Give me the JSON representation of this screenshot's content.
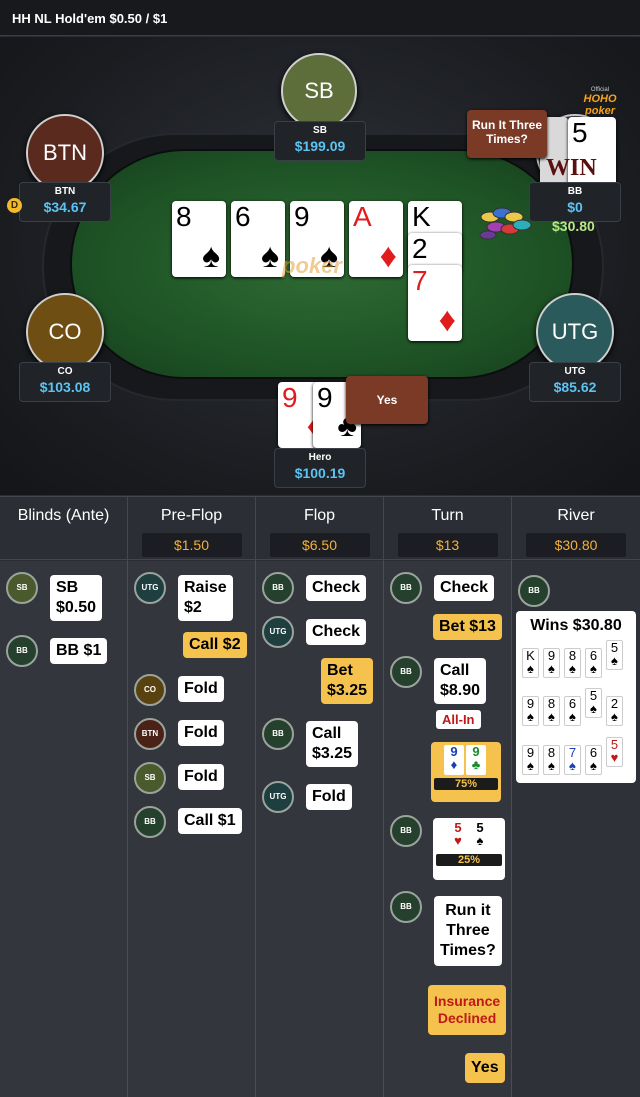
{
  "header": {
    "title": "HH NL Hold'em $0.50 / $1"
  },
  "brand": {
    "top": "Official",
    "name": "HOHO poker"
  },
  "seats": [
    {
      "id": "sb",
      "avatar": "SB",
      "name": "SB",
      "stack": "$199.09",
      "color": "#5d6e3a"
    },
    {
      "id": "btn",
      "avatar": "BTN",
      "name": "BTN",
      "stack": "$34.67",
      "color": "#5a2a1e"
    },
    {
      "id": "bb",
      "avatar": "",
      "name": "BB",
      "stack": "$0",
      "color": "#3a3d44"
    },
    {
      "id": "co",
      "avatar": "CO",
      "name": "CO",
      "stack": "$103.08",
      "color": "#6e4e12"
    },
    {
      "id": "utg",
      "avatar": "UTG",
      "name": "UTG",
      "stack": "$85.62",
      "color": "#2b5a5c"
    },
    {
      "id": "hero",
      "avatar": "",
      "name": "Hero",
      "stack": "$100.19",
      "color": "#8a2020"
    }
  ],
  "dealer_button": "D",
  "board": [
    {
      "rank": "8",
      "suit": "♠",
      "red": false
    },
    {
      "rank": "6",
      "suit": "♠",
      "red": false
    },
    {
      "rank": "9",
      "suit": "♠",
      "red": false
    },
    {
      "rank": "A",
      "suit": "♦",
      "red": true
    },
    {
      "rank": "K",
      "suit": "",
      "red": false
    },
    {
      "rank": "2",
      "suit": "",
      "red": false
    },
    {
      "rank": "7",
      "suit": "♦",
      "red": true
    }
  ],
  "hero_cards": [
    {
      "rank": "9",
      "suit": "♦",
      "red": true
    },
    {
      "rank": "9",
      "suit": "♣",
      "red": false
    }
  ],
  "bb_cards": [
    {
      "rank": "5",
      "suit": "",
      "red": false
    }
  ],
  "bubbles": {
    "run_it": "Run It Three Times?",
    "yes": "Yes",
    "win": "WIN",
    "bb_win_amount": "$30.80"
  },
  "streets": [
    {
      "name": "Blinds (Ante)",
      "pot": ""
    },
    {
      "name": "Pre-Flop",
      "pot": "$1.50"
    },
    {
      "name": "Flop",
      "pot": "$6.50"
    },
    {
      "name": "Turn",
      "pot": "$13"
    },
    {
      "name": "River",
      "pot": "$30.80"
    }
  ],
  "actions": {
    "blinds": [
      {
        "who": "SB",
        "text": "SB\n$0.50"
      },
      {
        "who": "BB",
        "text": "BB  $1"
      }
    ],
    "preflop": [
      {
        "who": "UTG",
        "text": "Raise\n$2"
      },
      {
        "who": "",
        "text": "Call  $2"
      },
      {
        "who": "CO",
        "text": "Fold"
      },
      {
        "who": "BTN",
        "text": "Fold"
      },
      {
        "who": "SB",
        "text": "Fold"
      },
      {
        "who": "BB",
        "text": "Call  $1"
      }
    ],
    "flop": [
      {
        "who": "BB",
        "text": "Check"
      },
      {
        "who": "UTG",
        "text": "Check"
      },
      {
        "who": "",
        "text": "Bet\n$3.25"
      },
      {
        "who": "BB",
        "text": "Call\n$3.25"
      },
      {
        "who": "UTG",
        "text": "Fold"
      }
    ],
    "turn": [
      {
        "who": "BB",
        "text": "Check"
      },
      {
        "who": "",
        "text": "Bet  $13"
      },
      {
        "who": "BB",
        "text": "Call\n$8.90"
      },
      {
        "who": "",
        "text": "All-In"
      },
      {
        "who": "",
        "text": "75%"
      },
      {
        "who": "BB",
        "text": "25%"
      },
      {
        "who": "BB",
        "text": "Run it\nThree\nTimes?"
      },
      {
        "who": "",
        "text": "Insurance\nDeclined"
      },
      {
        "who": "",
        "text": "Yes"
      }
    ],
    "river": {
      "who": "BB",
      "wins": "Wins $30.80"
    }
  },
  "equity": {
    "hero": "75%",
    "bb": "25%"
  },
  "run_boards": [
    [
      "K",
      "9",
      "8",
      "6",
      "5"
    ],
    [
      "9",
      "8",
      "6",
      "5",
      "2"
    ],
    [
      "9",
      "8",
      "7",
      "6",
      "5"
    ]
  ],
  "run_suits": [
    [
      "♠",
      "♠",
      "♠",
      "♠",
      "♠"
    ],
    [
      "♠",
      "♠",
      "♠",
      "♠",
      "♠"
    ],
    [
      "♠",
      "♠",
      "♠",
      "♠",
      "♥"
    ]
  ]
}
